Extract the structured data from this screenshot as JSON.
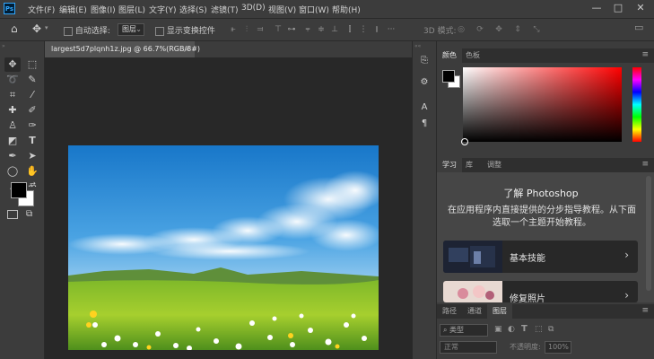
{
  "app": {
    "logo_text": "Ps",
    "brand_color": "#31a8ff"
  },
  "menu": {
    "items": [
      "文件(F)",
      "编辑(E)",
      "图像(I)",
      "图层(L)",
      "文字(Y)",
      "选择(S)",
      "滤镜(T)",
      "3D(D)",
      "视图(V)",
      "窗口(W)",
      "帮助(H)"
    ],
    "window_controls": [
      "—",
      "□",
      "✕"
    ]
  },
  "options": {
    "auto_select_label": "自动选择:",
    "layer_dropdown": "图层",
    "show_transform_label": "显示变换控件",
    "mode_3d_label": "3D 模式:"
  },
  "document": {
    "tab_title": "largest5d7plqnh1z.jpg @ 66.7%(RGB/8#)",
    "close": "×"
  },
  "color_panel": {
    "tabs": [
      "颜色",
      "色板"
    ],
    "active_tab": 0
  },
  "learn_panel": {
    "tabs": [
      "学习",
      "库",
      "调整"
    ],
    "active_tab": 0,
    "title": "了解 Photoshop",
    "description": "在应用程序内直接提供的分步指导教程。从下面选取一个主题开始教程。",
    "cards": [
      {
        "label": "基本技能",
        "chevron": "›"
      },
      {
        "label": "修复照片",
        "chevron": "›"
      }
    ]
  },
  "layers_panel": {
    "tabs": [
      "路径",
      "通道",
      "图层"
    ],
    "active_tab": 2,
    "filter_placeholder": "类型",
    "blend_mode": "正常",
    "opacity_label": "不透明度:",
    "opacity_value": "100%"
  },
  "colors": {
    "foreground": "#000000",
    "background": "#ffffff"
  }
}
